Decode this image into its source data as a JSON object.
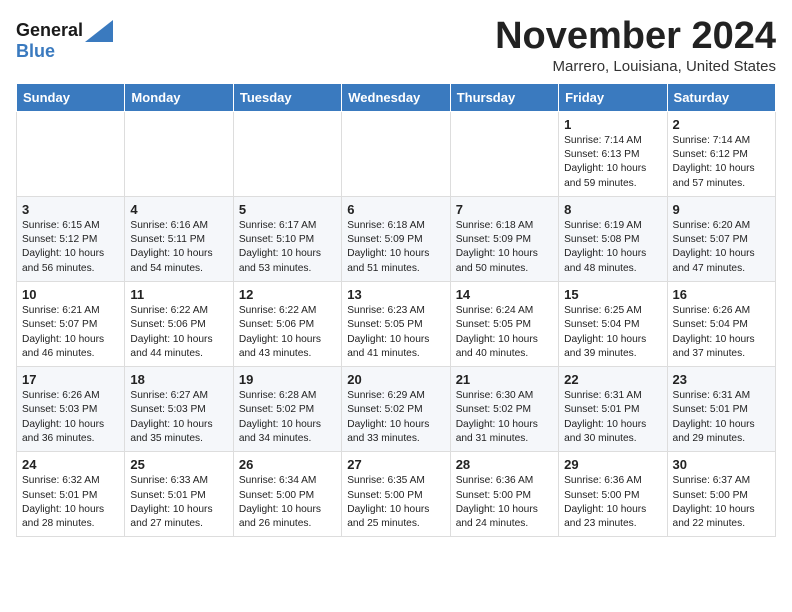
{
  "logo": {
    "line1": "General",
    "line2": "Blue"
  },
  "title": "November 2024",
  "subtitle": "Marrero, Louisiana, United States",
  "days_header": [
    "Sunday",
    "Monday",
    "Tuesday",
    "Wednesday",
    "Thursday",
    "Friday",
    "Saturday"
  ],
  "weeks": [
    [
      {
        "day": "",
        "content": ""
      },
      {
        "day": "",
        "content": ""
      },
      {
        "day": "",
        "content": ""
      },
      {
        "day": "",
        "content": ""
      },
      {
        "day": "",
        "content": ""
      },
      {
        "day": "1",
        "content": "Sunrise: 7:14 AM\nSunset: 6:13 PM\nDaylight: 10 hours\nand 59 minutes."
      },
      {
        "day": "2",
        "content": "Sunrise: 7:14 AM\nSunset: 6:12 PM\nDaylight: 10 hours\nand 57 minutes."
      }
    ],
    [
      {
        "day": "3",
        "content": "Sunrise: 6:15 AM\nSunset: 5:12 PM\nDaylight: 10 hours\nand 56 minutes."
      },
      {
        "day": "4",
        "content": "Sunrise: 6:16 AM\nSunset: 5:11 PM\nDaylight: 10 hours\nand 54 minutes."
      },
      {
        "day": "5",
        "content": "Sunrise: 6:17 AM\nSunset: 5:10 PM\nDaylight: 10 hours\nand 53 minutes."
      },
      {
        "day": "6",
        "content": "Sunrise: 6:18 AM\nSunset: 5:09 PM\nDaylight: 10 hours\nand 51 minutes."
      },
      {
        "day": "7",
        "content": "Sunrise: 6:18 AM\nSunset: 5:09 PM\nDaylight: 10 hours\nand 50 minutes."
      },
      {
        "day": "8",
        "content": "Sunrise: 6:19 AM\nSunset: 5:08 PM\nDaylight: 10 hours\nand 48 minutes."
      },
      {
        "day": "9",
        "content": "Sunrise: 6:20 AM\nSunset: 5:07 PM\nDaylight: 10 hours\nand 47 minutes."
      }
    ],
    [
      {
        "day": "10",
        "content": "Sunrise: 6:21 AM\nSunset: 5:07 PM\nDaylight: 10 hours\nand 46 minutes."
      },
      {
        "day": "11",
        "content": "Sunrise: 6:22 AM\nSunset: 5:06 PM\nDaylight: 10 hours\nand 44 minutes."
      },
      {
        "day": "12",
        "content": "Sunrise: 6:22 AM\nSunset: 5:06 PM\nDaylight: 10 hours\nand 43 minutes."
      },
      {
        "day": "13",
        "content": "Sunrise: 6:23 AM\nSunset: 5:05 PM\nDaylight: 10 hours\nand 41 minutes."
      },
      {
        "day": "14",
        "content": "Sunrise: 6:24 AM\nSunset: 5:05 PM\nDaylight: 10 hours\nand 40 minutes."
      },
      {
        "day": "15",
        "content": "Sunrise: 6:25 AM\nSunset: 5:04 PM\nDaylight: 10 hours\nand 39 minutes."
      },
      {
        "day": "16",
        "content": "Sunrise: 6:26 AM\nSunset: 5:04 PM\nDaylight: 10 hours\nand 37 minutes."
      }
    ],
    [
      {
        "day": "17",
        "content": "Sunrise: 6:26 AM\nSunset: 5:03 PM\nDaylight: 10 hours\nand 36 minutes."
      },
      {
        "day": "18",
        "content": "Sunrise: 6:27 AM\nSunset: 5:03 PM\nDaylight: 10 hours\nand 35 minutes."
      },
      {
        "day": "19",
        "content": "Sunrise: 6:28 AM\nSunset: 5:02 PM\nDaylight: 10 hours\nand 34 minutes."
      },
      {
        "day": "20",
        "content": "Sunrise: 6:29 AM\nSunset: 5:02 PM\nDaylight: 10 hours\nand 33 minutes."
      },
      {
        "day": "21",
        "content": "Sunrise: 6:30 AM\nSunset: 5:02 PM\nDaylight: 10 hours\nand 31 minutes."
      },
      {
        "day": "22",
        "content": "Sunrise: 6:31 AM\nSunset: 5:01 PM\nDaylight: 10 hours\nand 30 minutes."
      },
      {
        "day": "23",
        "content": "Sunrise: 6:31 AM\nSunset: 5:01 PM\nDaylight: 10 hours\nand 29 minutes."
      }
    ],
    [
      {
        "day": "24",
        "content": "Sunrise: 6:32 AM\nSunset: 5:01 PM\nDaylight: 10 hours\nand 28 minutes."
      },
      {
        "day": "25",
        "content": "Sunrise: 6:33 AM\nSunset: 5:01 PM\nDaylight: 10 hours\nand 27 minutes."
      },
      {
        "day": "26",
        "content": "Sunrise: 6:34 AM\nSunset: 5:00 PM\nDaylight: 10 hours\nand 26 minutes."
      },
      {
        "day": "27",
        "content": "Sunrise: 6:35 AM\nSunset: 5:00 PM\nDaylight: 10 hours\nand 25 minutes."
      },
      {
        "day": "28",
        "content": "Sunrise: 6:36 AM\nSunset: 5:00 PM\nDaylight: 10 hours\nand 24 minutes."
      },
      {
        "day": "29",
        "content": "Sunrise: 6:36 AM\nSunset: 5:00 PM\nDaylight: 10 hours\nand 23 minutes."
      },
      {
        "day": "30",
        "content": "Sunrise: 6:37 AM\nSunset: 5:00 PM\nDaylight: 10 hours\nand 22 minutes."
      }
    ]
  ]
}
